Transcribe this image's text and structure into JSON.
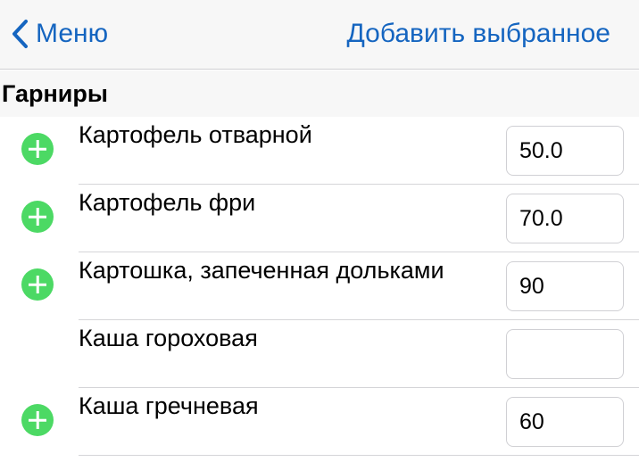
{
  "navbar": {
    "back_label": "Меню",
    "action_label": "Добавить выбранное",
    "accent_color": "#1565c0"
  },
  "section": {
    "title": "Гарниры"
  },
  "items": [
    {
      "name": "Картофель отварной",
      "amount": "50.0",
      "has_add": true
    },
    {
      "name": "Картофель фри",
      "amount": "70.0",
      "has_add": true
    },
    {
      "name": "Картошка, запеченная дольками",
      "amount": "90",
      "has_add": true
    },
    {
      "name": "Каша гороховая",
      "amount": "",
      "has_add": false
    },
    {
      "name": "Каша гречневая",
      "amount": "60",
      "has_add": true
    }
  ],
  "icons": {
    "back": "chevron-left-icon",
    "add": "plus-circle-icon"
  },
  "colors": {
    "add_icon": "#4cd964"
  }
}
